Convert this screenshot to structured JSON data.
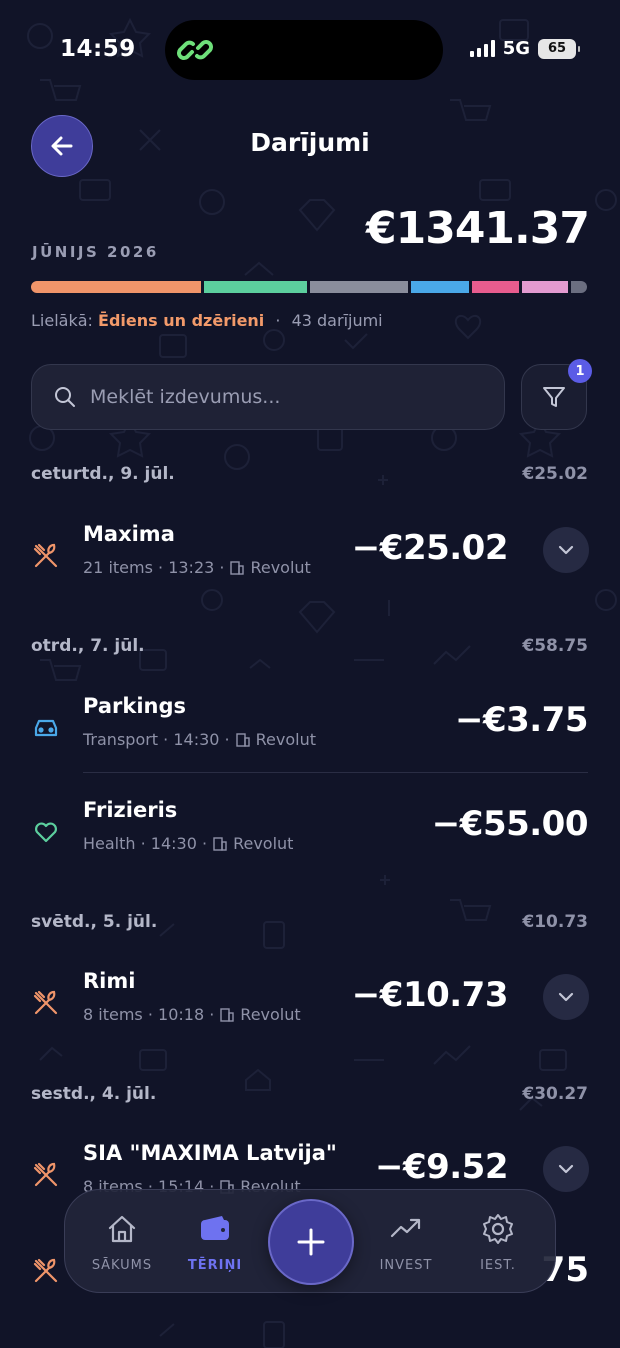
{
  "status": {
    "time": "14:59",
    "network": "5G",
    "battery": "65"
  },
  "header": {
    "title": "Darījumi",
    "back_icon": "arrow-left-icon"
  },
  "summary": {
    "month": "JŪNIJS 2026",
    "total": "€1341.37",
    "biggest_label": "Lielākā:",
    "biggest_category": "Ēdiens un dzērieni",
    "separator": "·",
    "count": "43 darījumi",
    "category_colors": [
      "#f0956a",
      "#5ccf9e",
      "#8a8d9c",
      "#4aa8e8",
      "#e85c8e",
      "#e39ad0",
      "#6b6e80"
    ]
  },
  "search": {
    "placeholder": "Meklēt izdevumus...",
    "value": "",
    "filter_badge": "1"
  },
  "days": [
    {
      "date": "ceturtd., 9. jūl.",
      "total": "€25.02",
      "transactions": [
        {
          "merchant": "Maxima",
          "meta": "21 items · 13:23 ·",
          "bank": "Revolut",
          "amount": "−€25.02",
          "icon": "fork-knife-icon",
          "expandable": true
        }
      ]
    },
    {
      "date": "otrd., 7. jūl.",
      "total": "€58.75",
      "transactions": [
        {
          "merchant": "Parkings",
          "meta": "Transport · 14:30 ·",
          "bank": "Revolut",
          "amount": "−€3.75",
          "icon": "car-icon",
          "expandable": false
        },
        {
          "merchant": "Frizieris",
          "meta": "Health · 14:30 ·",
          "bank": "Revolut",
          "amount": "−€55.00",
          "icon": "heart-icon",
          "expandable": false
        }
      ]
    },
    {
      "date": "svētd., 5. jūl.",
      "total": "€10.73",
      "transactions": [
        {
          "merchant": "Rimi",
          "meta": "8 items · 10:18 ·",
          "bank": "Revolut",
          "amount": "−€10.73",
          "icon": "fork-knife-icon",
          "expandable": true
        }
      ]
    },
    {
      "date": "sestd., 4. jūl.",
      "total": "€30.27",
      "transactions": [
        {
          "merchant": "SIA \"MAXIMA Latvija\"",
          "meta": "8 items · 15:14 ·",
          "bank": "Revolut",
          "amount": "−€9.52",
          "icon": "fork-knife-icon",
          "expandable": true
        }
      ]
    }
  ],
  "peek_amount": "75",
  "nav": {
    "home": "SĀKUMS",
    "spending": "TĒRIŅI",
    "invest": "INVEST",
    "settings": "IEST."
  }
}
